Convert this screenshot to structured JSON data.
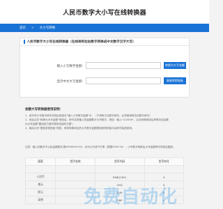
{
  "site": {
    "title": "人民币数字大小写在线转换器"
  },
  "nav": {
    "home": "首页",
    "sep": ">",
    "current": "大小写转换"
  },
  "card": {
    "title": "人民币数字大小写在线转换器（在线将阿拉伯数字转换成中文数字汉字大写）"
  },
  "form": {
    "row1": {
      "label": "输入小写数字金额:",
      "value": "",
      "placeholder": "",
      "button": "转换为大写金额"
    },
    "row2": {
      "label": "显示中文大写金额:",
      "value": "",
      "placeholder": "",
      "button": "复制到剪贴板"
    }
  },
  "info": {
    "title": "金额大写转换器使用说明：",
    "line1": "1、填写完小写数字填写完成后按钮在\"输入小写数字金额\"中，（于将阿中互数字填写，必须使用阿拉伯数字填写）",
    "line2": "2、然后点击\"转换为大写金额\"按钮后，即可实现输入的金额数字大写数字，例如：输入\"123456\"，点击转换按钮后获得对应结果",
    "line3": "为大写金额\"壹拾贰万叁仟肆佰伍拾陆元整\"；",
    "line4": "3、最后点击\"复制到剪贴板\"按钮，即将转换成后的大写数字金额复制到剪贴板中后即可粘贴使用。",
    "note": "注意：输入的数字不以负金额数字(数9999999.99)，也可以写成千亿等（根据9999.99），小写数字转换后大写金额再写完成后复制。"
  },
  "table": {
    "headers": [
      "国家",
      "货币名称",
      "货币代码",
      "货币符号"
    ],
    "rows": [
      [
        "",
        "",
        "",
        ""
      ],
      [
        "人民币",
        "",
        "RMB(CNY)",
        "¥"
      ],
      [
        "美元",
        "",
        "USD",
        "$"
      ],
      [
        "欧元",
        "",
        "EUR",
        "€"
      ],
      [
        "英镑",
        "",
        "GBP",
        "£"
      ]
    ]
  },
  "watermark": "免费自动化"
}
